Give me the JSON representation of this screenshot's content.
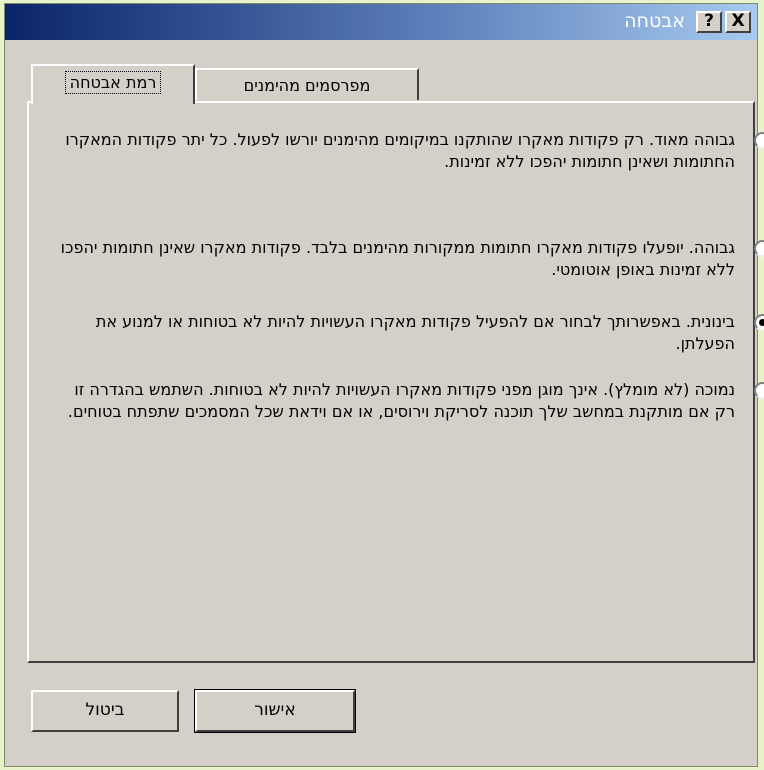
{
  "window": {
    "title": "אבטחה"
  },
  "titlebar_buttons": {
    "help": "?",
    "close": "X"
  },
  "tabs": [
    {
      "label": "רמת אבטחה",
      "selected": true
    },
    {
      "label": "מפרסמים מהימנים",
      "selected": false
    }
  ],
  "options": [
    {
      "name": "גבוהה מאוד",
      "text": ". רק פקודות מאקרו שהותקנו במיקומים מהימנים יורשו לפעול. כל יתר פקודות המאקרו החתומות ושאינן חתומות יהפכו ללא זמינות.",
      "checked": false
    },
    {
      "name": "גבוהה.",
      "text": " יופעלו פקודות מאקרו חתומות ממקורות מהימנים בלבד. פקודות מאקרו שאינן חתומות יהפכו ללא זמינות באופן אוטומטי.",
      "checked": false
    },
    {
      "name": "בינונית.",
      "text": " באפשרותך לבחור אם להפעיל פקודות מאקרו העשויות להיות לא בטוחות או למנוע את הפעלתן.",
      "checked": true
    },
    {
      "name": "נמוכה (לא מומלץ).",
      "text": " אינך מוגן מפני פקודות מאקרו העשויות להיות לא בטוחות. השתמש בהגדרה זו רק אם מותקנת במחשב שלך תוכנה לסריקת וירוסים, או אם וידאת שכל המסמכים שתפתח בטוחים.",
      "checked": false
    }
  ],
  "buttons": {
    "ok": "אישור",
    "cancel": "ביטול"
  },
  "colors": {
    "highlight_ring": "#1e8c12",
    "highlight_box": "#f06035"
  }
}
